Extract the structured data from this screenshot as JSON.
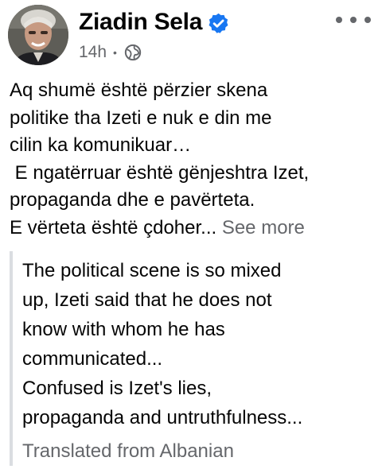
{
  "post": {
    "author": {
      "name": "Ziadin Sela",
      "verified": true,
      "avatar_icon": "profile-photo"
    },
    "time": "14h",
    "separator": "•",
    "audience_icon": "globe-icon",
    "body_lines": [
      "Aq shumë është përzier skena",
      "politike tha Izeti e nuk e din me",
      "cilin ka komunikuar…",
      " E ngatërruar është gënjeshtra Izet,",
      "propaganda dhe e pavërteta.",
      "E vërteta është çdoher..."
    ],
    "see_more": "See more",
    "translation": {
      "lines": [
        "The political scene is so mixed",
        "up, Izeti said that he does not",
        "know with whom he has",
        "communicated...",
        "Confused is Izet's lies,",
        "propaganda and untruthfulness..."
      ],
      "source_label": "Translated from Albanian"
    }
  },
  "colors": {
    "text_primary": "#050505",
    "text_secondary": "#65676b",
    "verified_blue": "#1877f2",
    "quote_bar": "#dadde1"
  }
}
